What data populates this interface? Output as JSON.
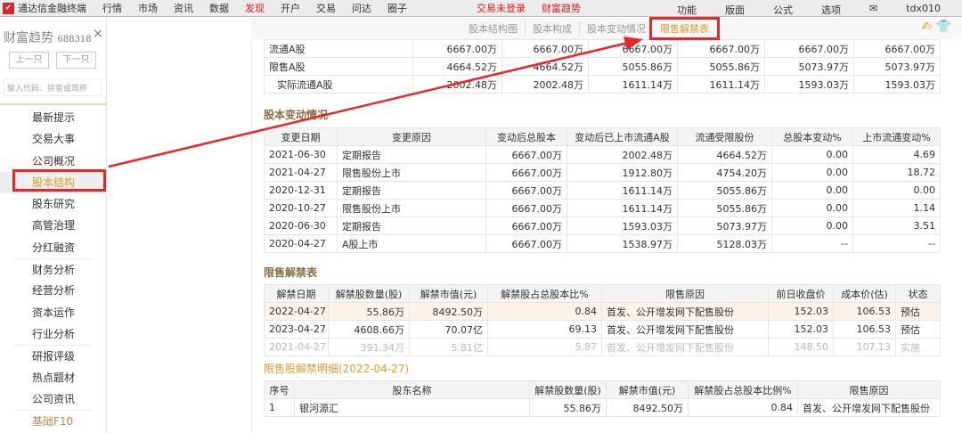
{
  "topbar": {
    "app": "通达信金融终端",
    "menus": [
      "行情",
      "市场",
      "资讯",
      "数据",
      "发现",
      "开户",
      "交易",
      "问达",
      "圈子"
    ],
    "active": "发现",
    "status": [
      "交易未登录",
      "财富趋势"
    ],
    "right": [
      "功能",
      "版面",
      "公式",
      "选项",
      "✉",
      "tdx010"
    ]
  },
  "sidebar": {
    "title": "财富趋势",
    "code": "688318",
    "close": "×",
    "prev": "上一只",
    "next": "下一只",
    "search_placeholder": "输入代码、拼音或简称",
    "items": [
      "最新提示",
      "交易大事",
      "公司概况",
      "股本结构",
      "股东研究",
      "高管治理",
      "分红融资",
      "财务分析",
      "经营分析",
      "资本运作",
      "行业分析",
      "研报评级",
      "热点题材",
      "公司资讯",
      "基础F10"
    ],
    "active": "股本结构"
  },
  "tabs": {
    "items": [
      "股本结构图",
      "股本构成",
      "股本变动情况",
      "限售解禁表"
    ],
    "active": "限售解禁表"
  },
  "colors": {
    "accent": "#e09b2f",
    "annotation": "#e8272b"
  },
  "structure_table": {
    "rows": [
      {
        "label": "流通A股",
        "values": [
          "6667.00万",
          "6667.00万",
          "6667.00万",
          "6667.00万",
          "6667.00万",
          "6667.00万"
        ]
      },
      {
        "label": "限售A股",
        "values": [
          "4664.52万",
          "4664.52万",
          "5055.86万",
          "5055.86万",
          "5073.97万",
          "5073.97万"
        ]
      },
      {
        "label": "实际流通A股",
        "values": [
          "2002.48万",
          "2002.48万",
          "1611.14万",
          "1611.14万",
          "1593.03万",
          "1593.03万"
        ]
      }
    ]
  },
  "change": {
    "title": "股本变动情况",
    "headers": [
      "变更日期",
      "变更原因",
      "变动后总股本",
      "变动后已上市流通A股",
      "流通受限股份",
      "总股本变动%",
      "上市流通变动%"
    ],
    "rows": [
      [
        "2021-06-30",
        "定期报告",
        "6667.00万",
        "2002.48万",
        "4664.52万",
        "0.00",
        "4.69"
      ],
      [
        "2021-04-27",
        "限售股份上市",
        "6667.00万",
        "1912.80万",
        "4754.20万",
        "0.00",
        "18.72"
      ],
      [
        "2020-12-31",
        "定期报告",
        "6667.00万",
        "1611.14万",
        "5055.86万",
        "0.00",
        "0.00"
      ],
      [
        "2020-10-27",
        "限售股份上市",
        "6667.00万",
        "1611.14万",
        "5055.86万",
        "0.00",
        "1.14"
      ],
      [
        "2020-06-30",
        "定期报告",
        "6667.00万",
        "1593.03万",
        "5073.97万",
        "0.00",
        "3.51"
      ],
      [
        "2020-04-27",
        "A股上市",
        "6667.00万",
        "1538.97万",
        "5128.03万",
        "--",
        "--"
      ]
    ]
  },
  "unlock": {
    "title": "限售解禁表",
    "headers": [
      "解禁日期",
      "解禁股数量(股)",
      "解禁市值(元)",
      "解禁股占总股本比%",
      "限售原因",
      "前日收盘价",
      "成本价(估)",
      "状态"
    ],
    "rows": [
      [
        "2022-04-27",
        "55.86万",
        "8492.50万",
        "0.84",
        "首发、公开增发网下配售股份",
        "152.03",
        "106.53",
        "预估"
      ],
      [
        "2023-04-27",
        "4608.66万",
        "70.07亿",
        "69.13",
        "首发、公开增发网下配售股份",
        "152.03",
        "106.53",
        "预估"
      ],
      [
        "2021-04-27",
        "391.34万",
        "5.81亿",
        "5.87",
        "首发、公开增发网下配售股份",
        "148.50",
        "107.13",
        "实施"
      ]
    ]
  },
  "detail": {
    "title": "限售股解禁明细(2022-04-27)",
    "headers": [
      "序号",
      "股东名称",
      "解禁股数量(股)",
      "解禁市值(元)",
      "解禁股占总股本比例%",
      "限售原因"
    ],
    "rows": [
      [
        "1",
        "银河源汇",
        "55.86万",
        "8492.50万",
        "0.84",
        "首发、公开增发网下配售股份"
      ]
    ]
  }
}
